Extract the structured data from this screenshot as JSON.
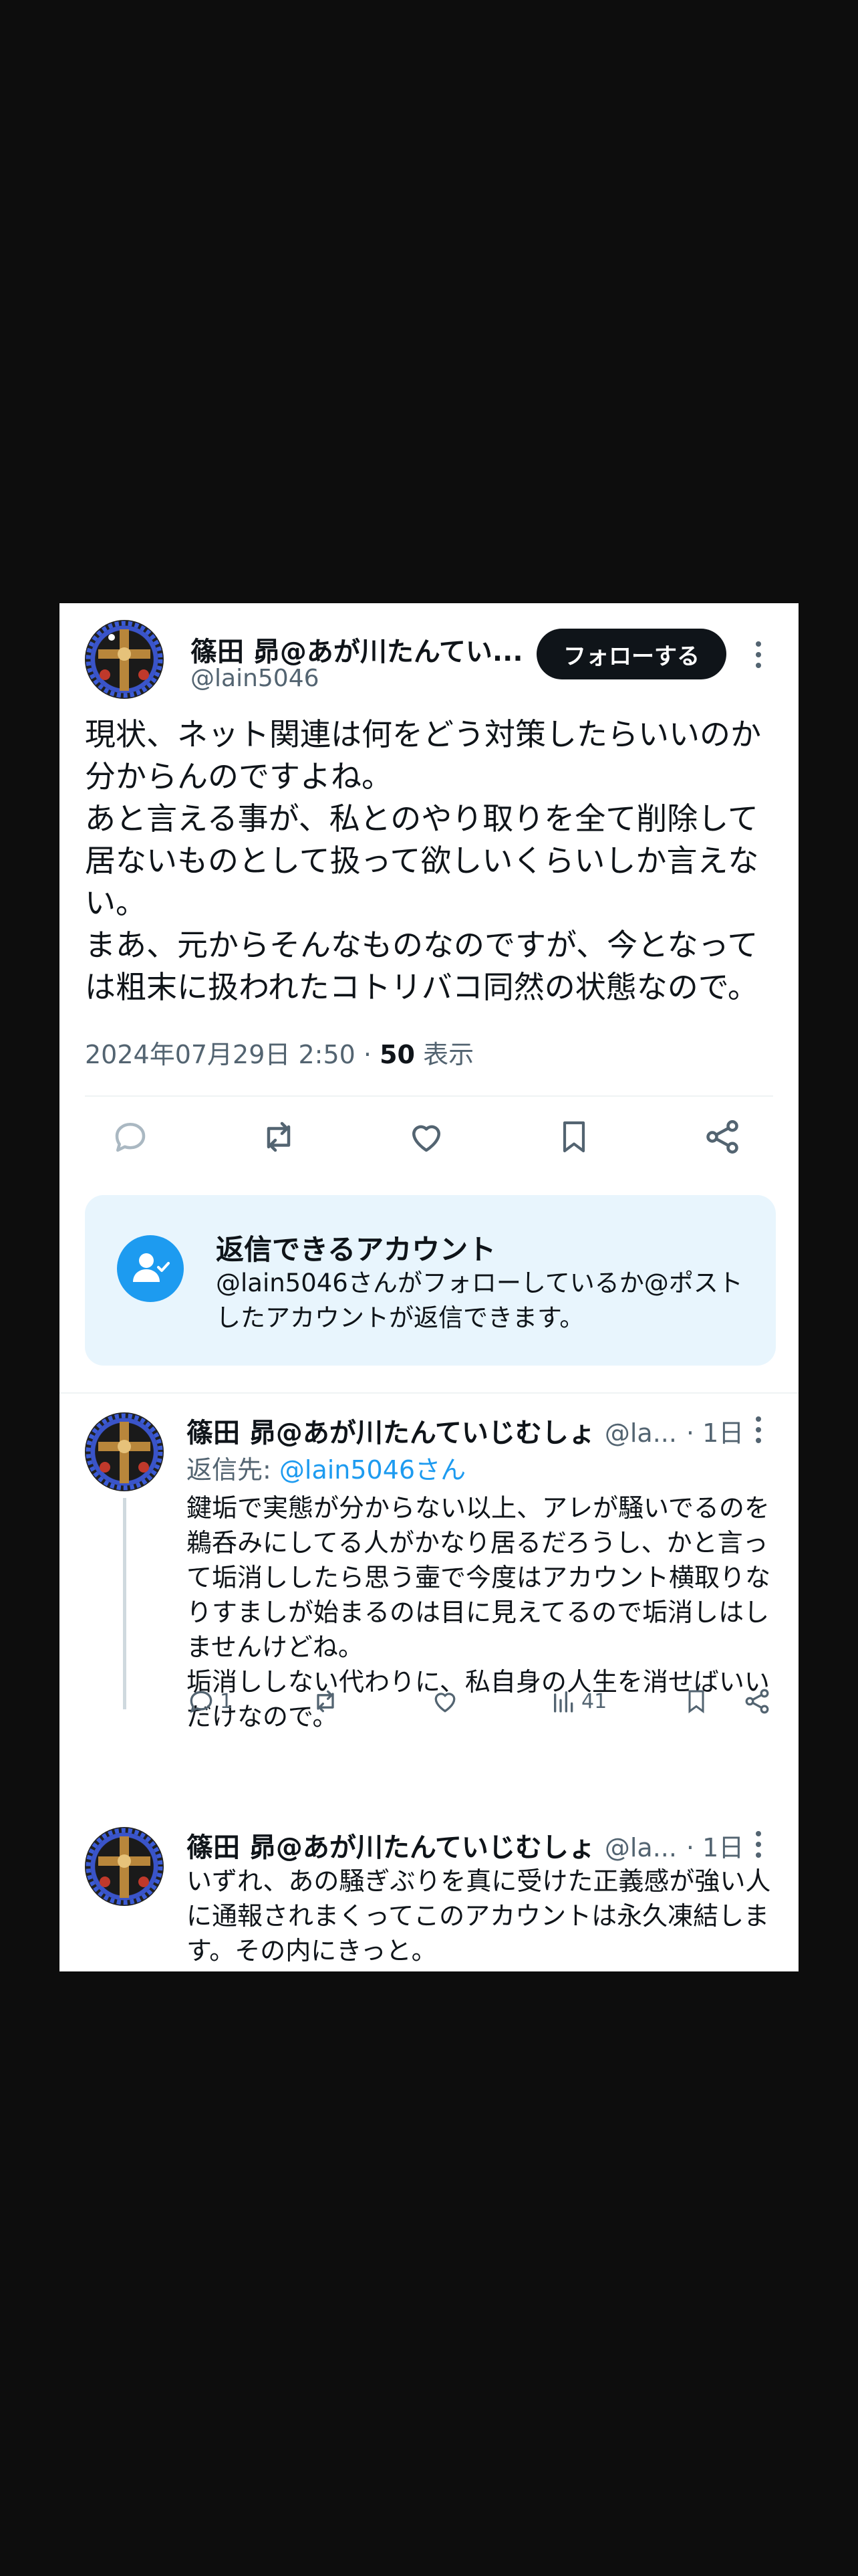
{
  "post": {
    "author_name": "篠田 昴@あが川たんてい...",
    "author_handle": "@lain5046",
    "follow_label": "フォローする",
    "text_lines": [
      "現状、ネット関連は何をどう対策したらいいのか分からんのですよね。",
      "あと言える事が、私とのやり取りを全て削除して居ないものとして扱って欲しいくらいしか言えない。",
      "まあ、元からそんなものなのですが、今となっては粗末に扱われたコトリバコ同然の状態なので。"
    ],
    "timestamp": "2024年07月29日 2:50",
    "views_count": "50",
    "views_label": "表示"
  },
  "icons": [
    "reply-icon",
    "retweet-icon",
    "like-icon",
    "bookmark-icon",
    "share-icon",
    "more-icon",
    "views-icon",
    "person-check-icon"
  ],
  "reply_restriction": {
    "title": "返信できるアカウント",
    "description": "@lain5046さんがフォローしているか@ポストしたアカウントが返信できます。"
  },
  "replies": [
    {
      "author_name": "篠田 昴@あが川たんていじむしょ",
      "author_handle": "@la...",
      "time": "· 1日",
      "reply_to_prefix": "返信先: ",
      "reply_to_handle": "@lain5046さん",
      "text_lines": [
        "鍵垢で実態が分からない以上、アレが騒いでるのを鵜呑みにしてる人がかなり居るだろうし、かと言って垢消ししたら思う壷で今度はアカウント横取りなりすましが始まるのは目に見えてるので垢消しはしませんけどね。",
        "垢消ししない代わりに、私自身の人生を消せばいいだけなので。"
      ],
      "reply_count": "1",
      "views_count": "41"
    },
    {
      "author_name": "篠田 昴@あが川たんていじむしょ",
      "author_handle": "@la...",
      "time": "· 1日",
      "text_lines": [
        "いずれ、あの騒ぎぶりを真に受けた正義感が強い人に通報されまくってこのアカウントは永久凍結します。その内にきっと。"
      ]
    }
  ],
  "colors": {
    "accent": "#1d9bf0",
    "text": "#0f1419",
    "secondary": "#536471",
    "reply_box_bg": "#e8f5fd",
    "backdrop": "#0d0d0d"
  }
}
